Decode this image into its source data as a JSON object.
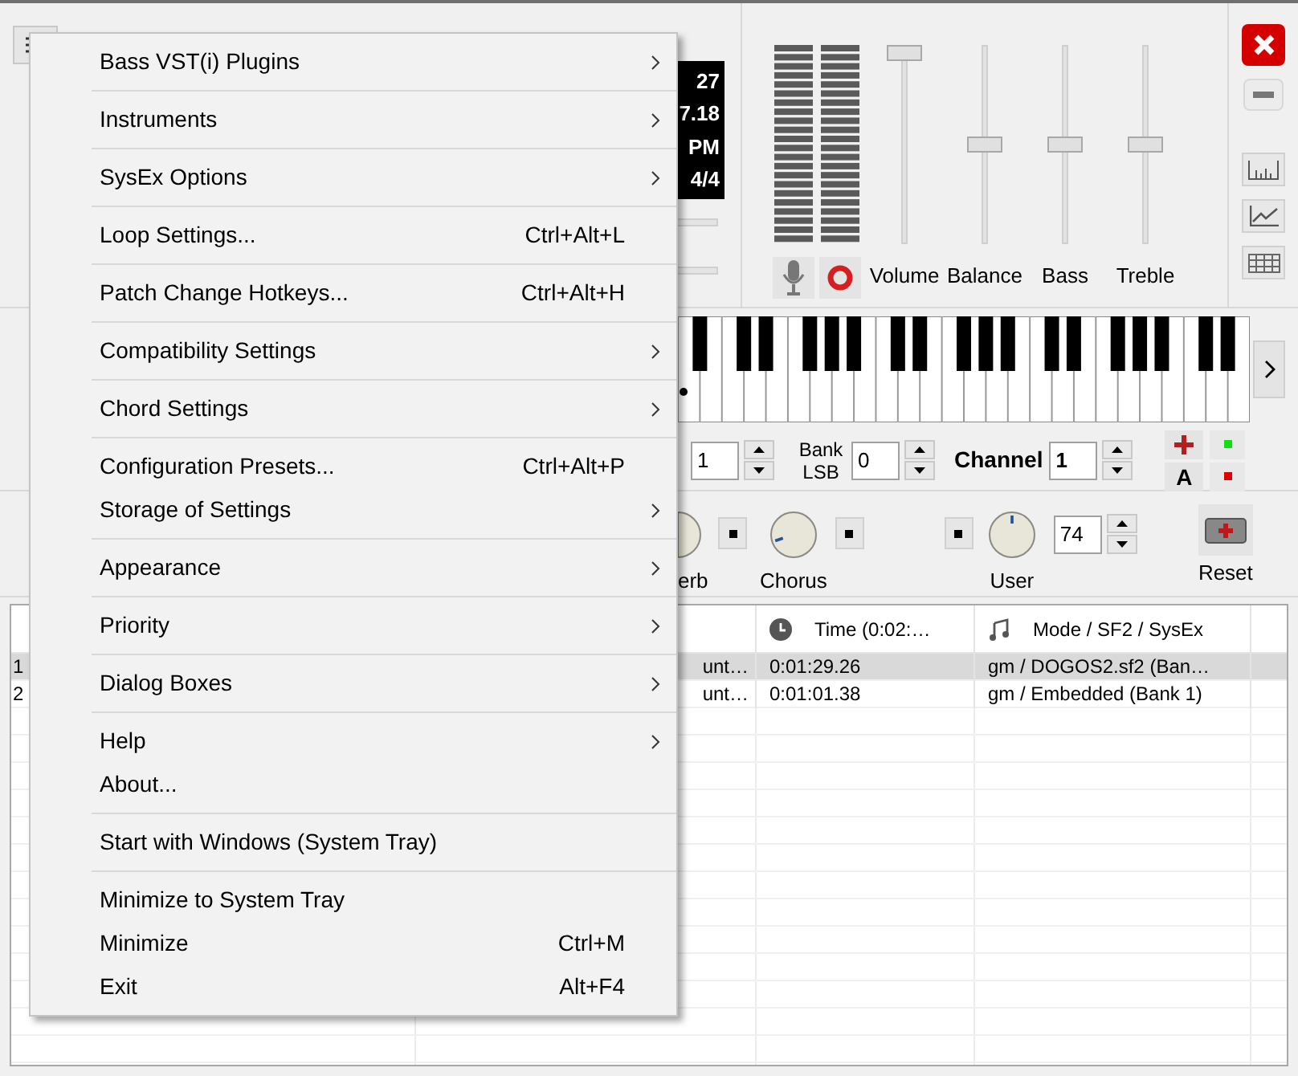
{
  "menu": {
    "groups": [
      [
        {
          "label": "Bass VST(i) Plugins",
          "submenu": true
        }
      ],
      [
        {
          "label": "Instruments",
          "submenu": true
        }
      ],
      [
        {
          "label": "SysEx Options",
          "submenu": true
        }
      ],
      [
        {
          "label": "Loop Settings...",
          "shortcut": "Ctrl+Alt+L",
          "submenu": false
        }
      ],
      [
        {
          "label": "Patch Change Hotkeys...",
          "shortcut": "Ctrl+Alt+H",
          "submenu": false
        }
      ],
      [
        {
          "label": "Compatibility Settings",
          "submenu": true
        }
      ],
      [
        {
          "label": "Chord Settings",
          "submenu": true
        }
      ],
      [
        {
          "label": "Configuration Presets...",
          "shortcut": "Ctrl+Alt+P",
          "submenu": false
        },
        {
          "label": "Storage of Settings",
          "submenu": true
        }
      ],
      [
        {
          "label": "Appearance",
          "submenu": true
        }
      ],
      [
        {
          "label": "Priority",
          "submenu": true
        }
      ],
      [
        {
          "label": "Dialog Boxes",
          "submenu": true
        }
      ],
      [
        {
          "label": "Help",
          "submenu": true
        },
        {
          "label": "About...",
          "submenu": false
        }
      ],
      [
        {
          "label": "Start with Windows (System Tray)",
          "submenu": false
        }
      ],
      [
        {
          "label": "Minimize to System Tray",
          "submenu": false
        },
        {
          "label": "Minimize",
          "shortcut": "Ctrl+M",
          "submenu": false
        },
        {
          "label": "Exit",
          "shortcut": "Alt+F4",
          "submenu": false
        }
      ]
    ]
  },
  "display": {
    "lines": [
      "27",
      "7.18",
      "PM",
      "4/4"
    ]
  },
  "mixer": {
    "sliders": [
      {
        "label": "Volume",
        "level": 1
      },
      {
        "label": "Balance",
        "level": 0.5
      },
      {
        "label": "Bass",
        "level": 0.5
      },
      {
        "label": "Treble",
        "level": 0.5
      }
    ]
  },
  "controls": {
    "program_value": "1",
    "bank_label": "Bank LSB",
    "bank_value": "0",
    "channel_label": "Channel",
    "channel_value": "1",
    "accent_label": "A"
  },
  "effects": {
    "reverb_label": "erb",
    "chorus": {
      "label": "Chorus",
      "level": 0.1
    },
    "user": {
      "label": "User",
      "level": 0.5,
      "value": "74"
    },
    "reset_label": "Reset"
  },
  "table": {
    "columns": [
      "Time (0:02:…",
      "Mode / SF2 / SysEx"
    ],
    "rows": [
      {
        "number": "1",
        "column_2": "unt…",
        "time": "0:01:29.26",
        "mode": "gm / DOGOS2.sf2 (Ban…",
        "selected": true
      },
      {
        "number": "2",
        "column_2": "unt…",
        "time": "0:01:01.38",
        "mode": "gm / Embedded (Bank 1)",
        "selected": false
      }
    ]
  }
}
